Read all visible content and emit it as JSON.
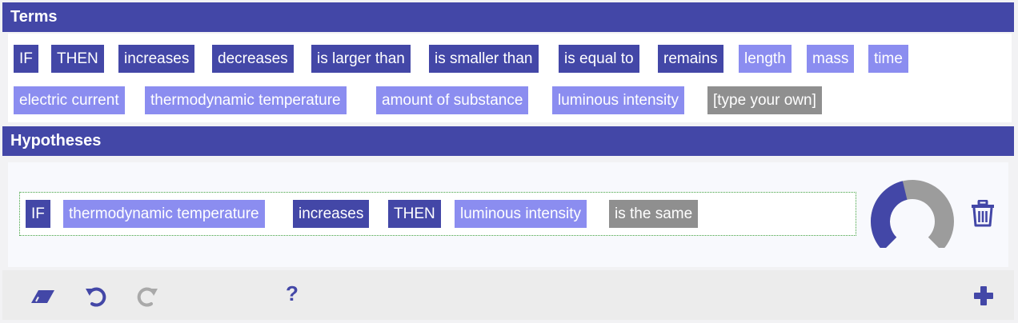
{
  "sections": {
    "terms_title": "Terms",
    "hypotheses_title": "Hypotheses"
  },
  "terms": [
    {
      "label": "IF",
      "kind": "operator"
    },
    {
      "label": "THEN",
      "kind": "operator"
    },
    {
      "label": "increases",
      "kind": "operator"
    },
    {
      "label": "decreases",
      "kind": "operator"
    },
    {
      "label": "is larger than",
      "kind": "operator"
    },
    {
      "label": "is smaller than",
      "kind": "operator"
    },
    {
      "label": "is equal to",
      "kind": "operator"
    },
    {
      "label": "remains",
      "kind": "operator"
    },
    {
      "label": "length",
      "kind": "variable"
    },
    {
      "label": "mass",
      "kind": "variable"
    },
    {
      "label": "time",
      "kind": "variable"
    },
    {
      "label": "electric current",
      "kind": "variable"
    },
    {
      "label": "thermodynamic temperature",
      "kind": "variable"
    },
    {
      "label": "amount of substance",
      "kind": "variable"
    },
    {
      "label": "luminous intensity",
      "kind": "variable"
    },
    {
      "label": "[type your own]",
      "kind": "custom"
    }
  ],
  "hypothesis": {
    "chips": [
      {
        "label": "IF",
        "kind": "operator"
      },
      {
        "label": "thermodynamic temperature",
        "kind": "variable"
      },
      {
        "label": "increases",
        "kind": "operator"
      },
      {
        "label": "THEN",
        "kind": "operator"
      },
      {
        "label": "luminous intensity",
        "kind": "variable"
      },
      {
        "label": "is the same",
        "kind": "custom"
      }
    ],
    "completion_fraction": 0.45
  },
  "toolbar": {
    "icons": [
      "eraser-icon",
      "undo-icon",
      "redo-icon",
      "help-icon",
      "add-icon"
    ],
    "help_label": "?"
  },
  "colors": {
    "header": "#4347a7",
    "operator": "#4347a7",
    "variable": "#8b8df0",
    "custom": "#8f8f8f",
    "donut_filled": "#4347a7",
    "donut_empty": "#9c9c9c"
  }
}
